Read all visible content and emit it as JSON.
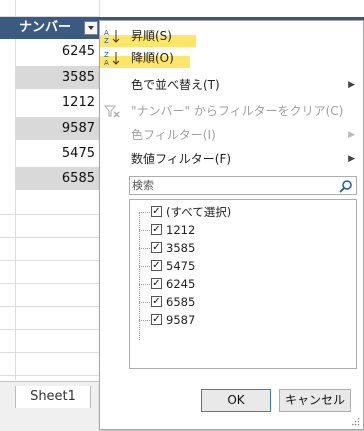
{
  "sheet": {
    "column_header": "ナンバー",
    "cells": [
      "6245",
      "3585",
      "1212",
      "9587",
      "5475",
      "6585"
    ],
    "tab_label": "Sheet1"
  },
  "menu": {
    "sort_asc": "昇順(S)",
    "sort_desc": "降順(O)",
    "sort_by_color": "色で並べ替え(T)",
    "clear_filter": "\"ナンバー\" からフィルターをクリア(C)",
    "color_filter": "色フィルター(I)",
    "number_filter": "数値フィルター(F)"
  },
  "search": {
    "placeholder": "検索"
  },
  "list": {
    "select_all": "(すべて選択)",
    "items": [
      "1212",
      "3585",
      "5475",
      "6245",
      "6585",
      "9587"
    ],
    "checkmark": "✓"
  },
  "buttons": {
    "ok": "OK",
    "cancel": "キャンセル"
  },
  "colors": {
    "header_bg": "#3a5a82",
    "highlight": "#ffe14d",
    "ok_border": "#3c7fb1"
  }
}
